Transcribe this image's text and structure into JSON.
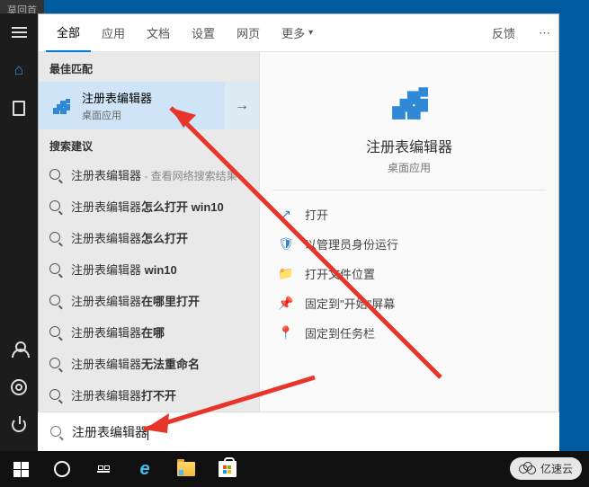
{
  "browser_tab": "莫回首",
  "tabs": {
    "all": "全部",
    "apps": "应用",
    "docs": "文档",
    "settings": "设置",
    "web": "网页",
    "more": "更多",
    "feedback": "反馈"
  },
  "best_match_section": "最佳匹配",
  "best_match": {
    "title": "注册表编辑器",
    "subtitle": "桌面应用"
  },
  "suggestions_section": "搜索建议",
  "suggestions": [
    {
      "prefix": "注册表编辑器",
      "bold": "",
      "hint": " - 查看网络搜索结果"
    },
    {
      "prefix": "注册表编辑器",
      "bold": "怎么打开 win10",
      "hint": ""
    },
    {
      "prefix": "注册表编辑器",
      "bold": "怎么打开",
      "hint": ""
    },
    {
      "prefix": "注册表编辑器",
      "bold": " win10",
      "hint": ""
    },
    {
      "prefix": "注册表编辑器",
      "bold": "在哪里打开",
      "hint": ""
    },
    {
      "prefix": "注册表编辑器",
      "bold": "在哪",
      "hint": ""
    },
    {
      "prefix": "注册表编辑器",
      "bold": "无法重命名",
      "hint": ""
    },
    {
      "prefix": "注册表编辑器",
      "bold": "打不开",
      "hint": ""
    }
  ],
  "detail": {
    "title": "注册表编辑器",
    "subtitle": "桌面应用"
  },
  "actions": {
    "open": "打开",
    "admin": "以管理员身份运行",
    "location": "打开文件位置",
    "pin_start": "固定到\"开始\"屏幕",
    "pin_taskbar": "固定到任务栏"
  },
  "search_input": "注册表编辑器",
  "watermark": "亿速云",
  "icons": {
    "open": "↗",
    "admin": "🛡",
    "location": "📁",
    "pin_start": "📌",
    "pin_taskbar": "📍",
    "ellipsis": "⋯",
    "arrow": "→"
  }
}
